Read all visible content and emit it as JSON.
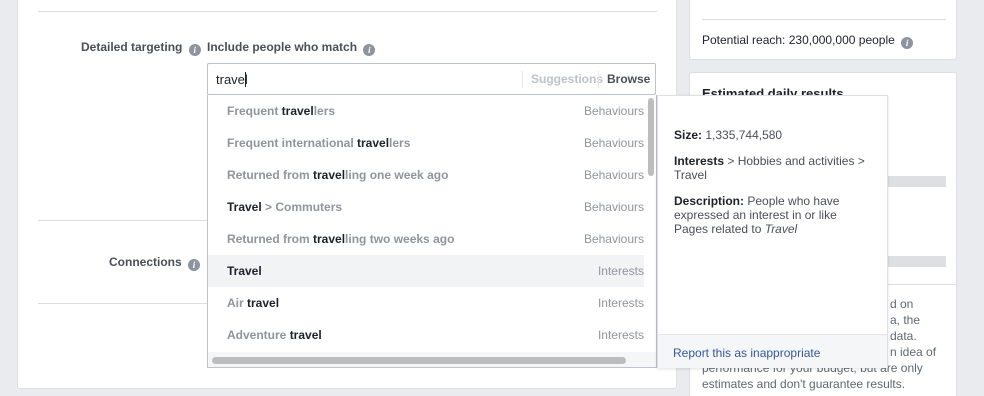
{
  "targeting": {
    "detailed_label": "Detailed targeting",
    "include_label": "Include people who match",
    "connections_label": "Connections"
  },
  "search": {
    "value": "travel",
    "suggestions_tab": "Suggestions",
    "browse_tab": "Browse"
  },
  "dropdown": {
    "items": [
      {
        "pre": "Frequent ",
        "bold": "travel",
        "post": "lers",
        "category": "Behaviours"
      },
      {
        "pre": "Frequent international ",
        "bold": "travel",
        "post": "lers",
        "category": "Behaviours"
      },
      {
        "pre": "Returned from ",
        "bold": "travel",
        "post": "ling one week ago",
        "category": "Behaviours"
      },
      {
        "bold": "Travel",
        "post": " > Commuters",
        "category": "Behaviours"
      },
      {
        "pre": "Returned from ",
        "bold": "travel",
        "post": "ling two weeks ago",
        "category": "Behaviours"
      },
      {
        "bold": "Travel",
        "category": "Interests"
      },
      {
        "pre": "Air ",
        "bold": "travel",
        "category": "Interests"
      },
      {
        "pre": "Adventure ",
        "bold": "travel",
        "category": "Interests"
      }
    ]
  },
  "popover": {
    "size_label": "Size:",
    "size_value": "1,335,744,580",
    "path_label": "Interests",
    "path_rest": " > Hobbies and activities > Travel",
    "desc_label": "Description:",
    "desc_text": "People who have expressed an interest in or like Pages related to",
    "desc_italic": "Travel",
    "report_link": "Report this as inappropriate"
  },
  "sidebar": {
    "reach_prefix": "Potential reach: ",
    "reach_value": "230,000,000 people",
    "results_title": "Estimated daily results",
    "partial_lines": [
      "d on",
      "a, the",
      "data.",
      "n idea of",
      "performance for your budget, but are only",
      "estimates and don't guarantee results."
    ]
  }
}
